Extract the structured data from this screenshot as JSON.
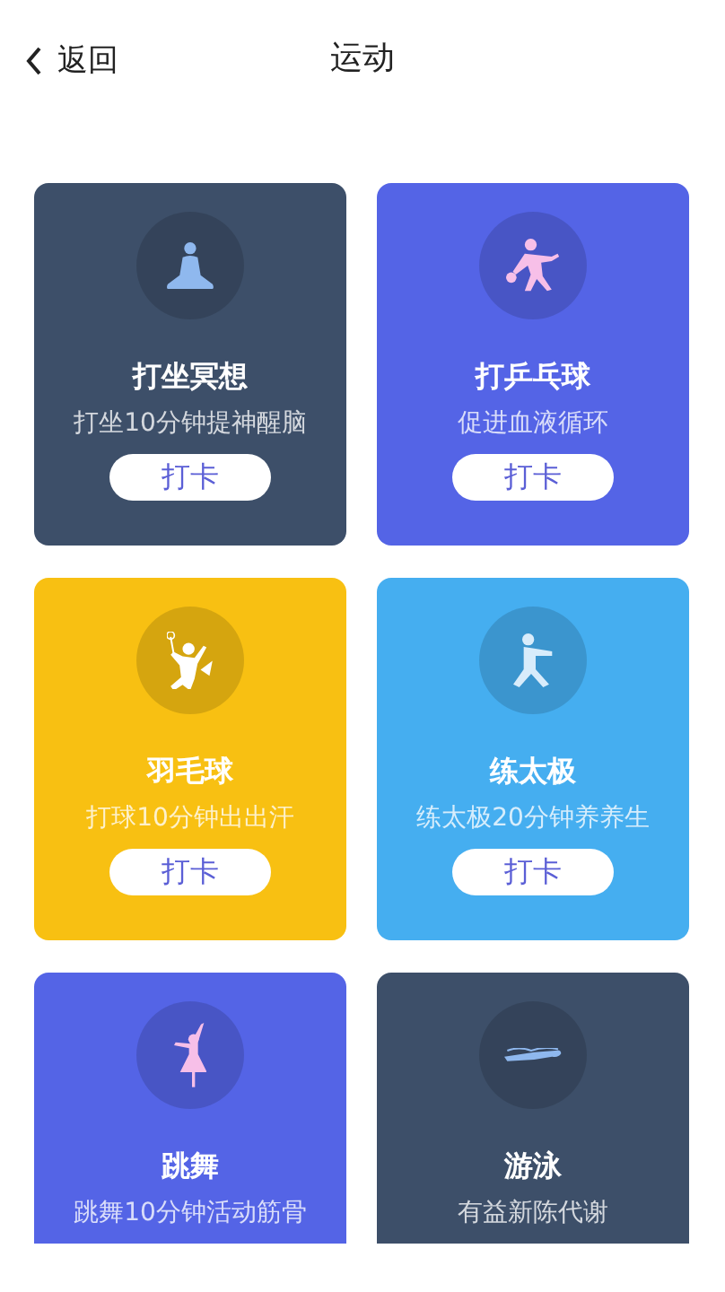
{
  "header": {
    "back_label": "返回",
    "title": "运动"
  },
  "cards": [
    {
      "title": "打坐冥想",
      "subtitle": "打坐10分钟提神醒脑",
      "button": "打卡",
      "color": "#3d4f69"
    },
    {
      "title": "打乒乓球",
      "subtitle": "促进血液循环",
      "button": "打卡",
      "color": "#5464e6"
    },
    {
      "title": "羽毛球",
      "subtitle": "打球10分钟出出汗",
      "button": "打卡",
      "color": "#f8c012"
    },
    {
      "title": "练太极",
      "subtitle": "练太极20分钟养养生",
      "button": "打卡",
      "color": "#45aef0"
    },
    {
      "title": "跳舞",
      "subtitle": "跳舞10分钟活动筋骨",
      "color": "#5464e6"
    },
    {
      "title": "游泳",
      "subtitle": "有益新陈代谢",
      "color": "#3d4f69"
    }
  ]
}
